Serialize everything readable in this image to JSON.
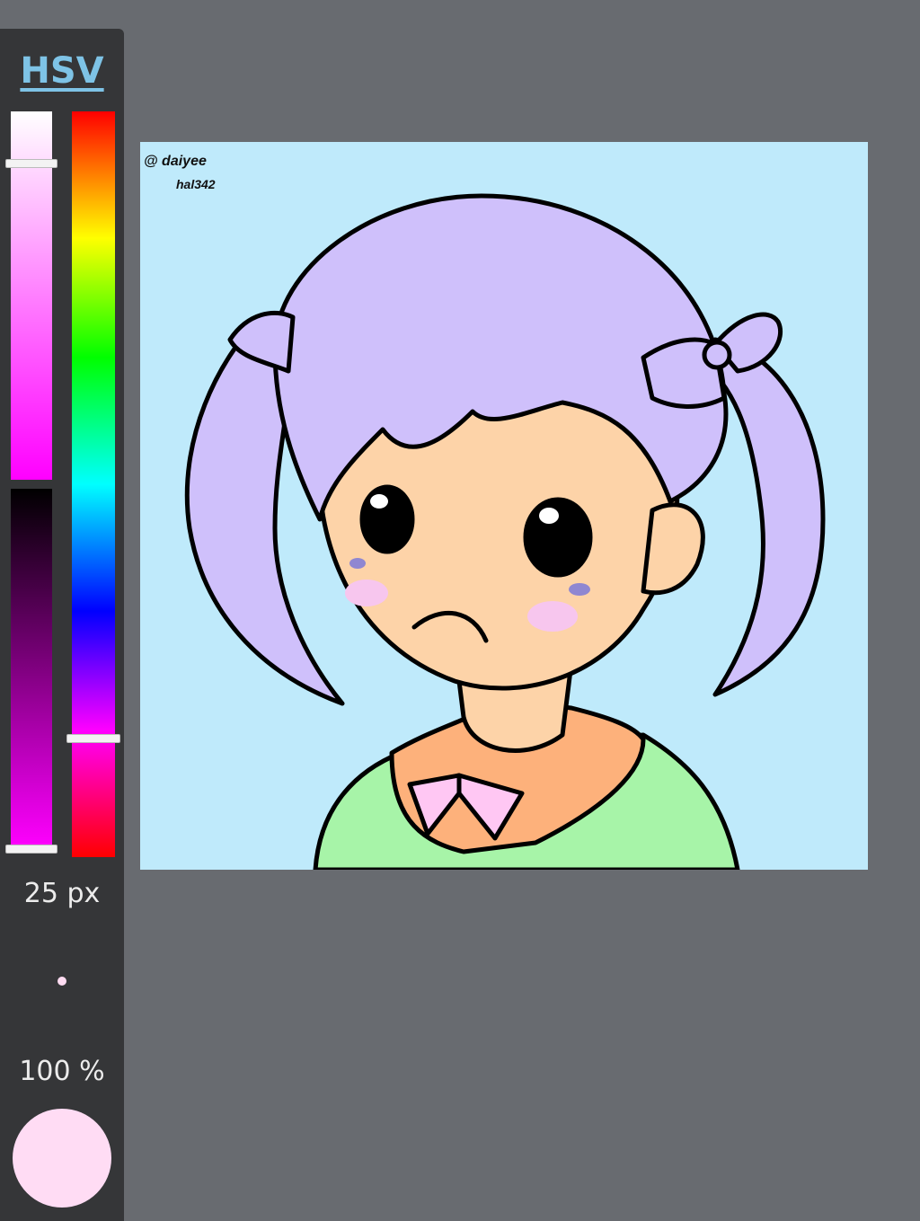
{
  "toolbar": {
    "mode_label": "HSV",
    "brush_size_label": "25 px",
    "opacity_label": "100 %",
    "saturation_level": 0.14,
    "hue_level": 0.84,
    "value_level": 1.0
  },
  "colors": {
    "current_color": "#ffdcf4",
    "accent": "#7ec3e6",
    "canvas_background": "#bfeafb"
  },
  "canvas": {
    "watermark_line1": "@ daiyee",
    "watermark_line2": "hal342"
  }
}
